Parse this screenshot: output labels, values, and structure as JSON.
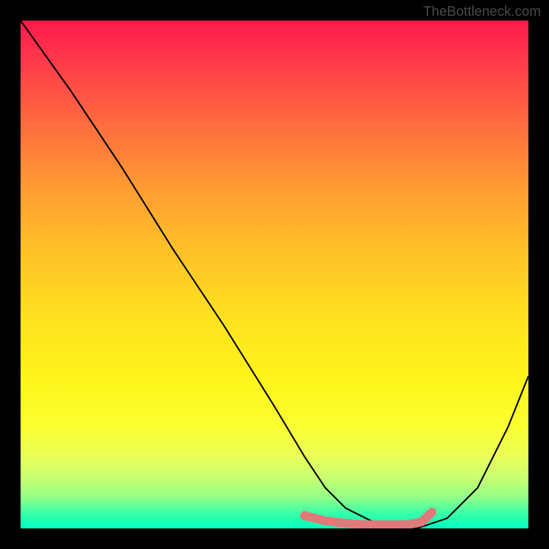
{
  "watermark": "TheBottleneck.com",
  "chart_data": {
    "type": "line",
    "title": "",
    "xlabel": "",
    "ylabel": "",
    "xlim": [
      0,
      100
    ],
    "ylim": [
      0,
      100
    ],
    "series": [
      {
        "name": "bottleneck-curve",
        "x": [
          0,
          10,
          20,
          30,
          40,
          50,
          56,
          60,
          64,
          70,
          74,
          78,
          84,
          90,
          96,
          100
        ],
        "y": [
          100,
          86,
          71,
          55,
          40,
          24,
          14,
          8,
          4,
          1,
          0,
          0,
          2,
          8,
          20,
          30
        ]
      }
    ],
    "highlight_segment": {
      "name": "optimal-range",
      "x": [
        56,
        60,
        64,
        68,
        72,
        76,
        79,
        81
      ],
      "y": [
        2.5,
        1.5,
        1,
        0.7,
        0.7,
        0.7,
        1.3,
        3.2
      ]
    },
    "gradient_colors": {
      "top": "#ff1a4c",
      "mid": "#fff41a",
      "bottom": "#00ffc0"
    }
  }
}
